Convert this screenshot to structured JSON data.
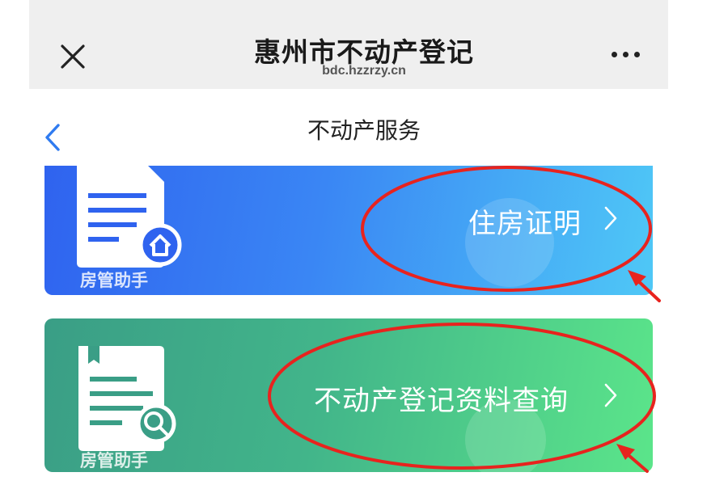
{
  "header": {
    "title": "惠州市不动产登记",
    "subtitle": "bdc.hzzrzy.cn"
  },
  "nav": {
    "title": "不动产服务"
  },
  "cards": [
    {
      "label": "住房证明",
      "watermark": "房管助手",
      "icon": "document-home-icon"
    },
    {
      "label": "不动产登记资料查询",
      "watermark": "房管助手",
      "icon": "document-search-icon"
    }
  ],
  "colors": {
    "card_blue_start": "#2f63ef",
    "card_blue_end": "#4fc8f6",
    "card_green_start": "#3a9e86",
    "card_green_end": "#5be58a",
    "annotation_red": "#e8231e",
    "back_arrow": "#2f7bf0"
  }
}
